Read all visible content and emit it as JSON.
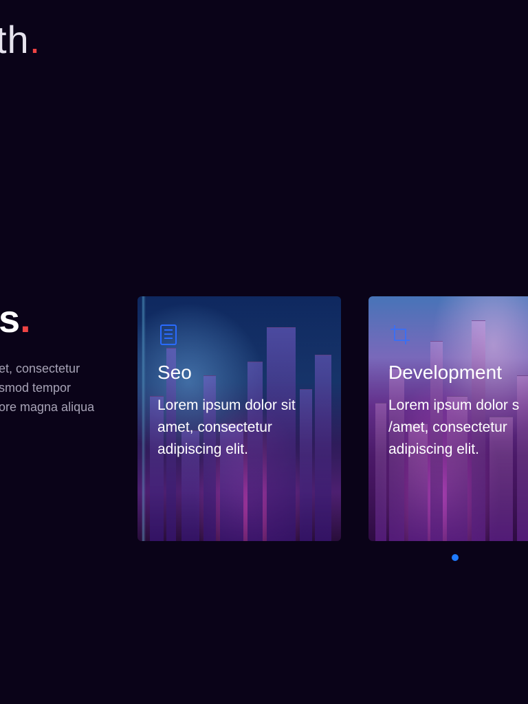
{
  "hero": {
    "title_fragment": "th",
    "dot": "."
  },
  "section": {
    "title_fragment": "s",
    "dot": ".",
    "lines": [
      "et, consectetur",
      "smod tempor",
      "ore magna aliqua"
    ]
  },
  "cards": [
    {
      "title": "Seo",
      "icon": "document-icon",
      "lines": [
        "Lorem ipsum dolor sit",
        "amet, consectetur",
        "adipiscing elit."
      ]
    },
    {
      "title": "Development",
      "icon": "crop-icon",
      "lines": [
        "Lorem ipsum dolor s",
        "/amet, consectetur",
        "adipiscing elit."
      ]
    }
  ],
  "pagination": {
    "active_index": 0,
    "active_color": "#1f7bff"
  },
  "colors": {
    "background": "#0a0318",
    "accent_red": "#ef4444",
    "icon_blue": "#2a6bff"
  }
}
